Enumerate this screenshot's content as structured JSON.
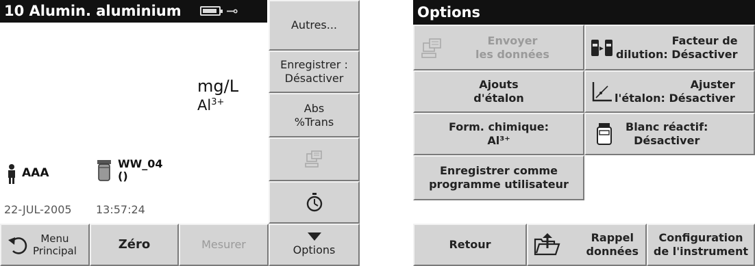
{
  "left": {
    "title": "10 Alumin. aluminium",
    "unit": "mg/L",
    "formula_base": "Al",
    "formula_sup": "3+",
    "user": "AAA",
    "sample": "WW_04\n()",
    "date": "22-JUL-2005",
    "time": "13:57:24",
    "side_buttons": {
      "autres": "Autres...",
      "enregistrer": "Enregistrer : Désactiver",
      "abs_trans": "Abs\n%Trans"
    },
    "bottom_buttons": {
      "menu": "Menu\nPrincipal",
      "zero": "Zéro",
      "mesurer": "Mesurer",
      "options": "Options"
    }
  },
  "right": {
    "title": "Options",
    "buttons": {
      "envoyer": "Envoyer\nles données",
      "facteur": "Facteur de\ndilution: Désactiver",
      "ajouts": "Ajouts\nd'étalon",
      "ajuster": "Ajuster\nl'étalon: Désactiver",
      "form_chimique": "Form. chimique:\nAl³⁺",
      "blanc": "Blanc réactif:\nDésactiver",
      "enregistrer_prog": "Enregistrer comme\nprogramme utilisateur",
      "retour": "Retour",
      "rappel": "Rappel\ndonnées",
      "configuration": "Configuration\nde l'instrument"
    }
  }
}
